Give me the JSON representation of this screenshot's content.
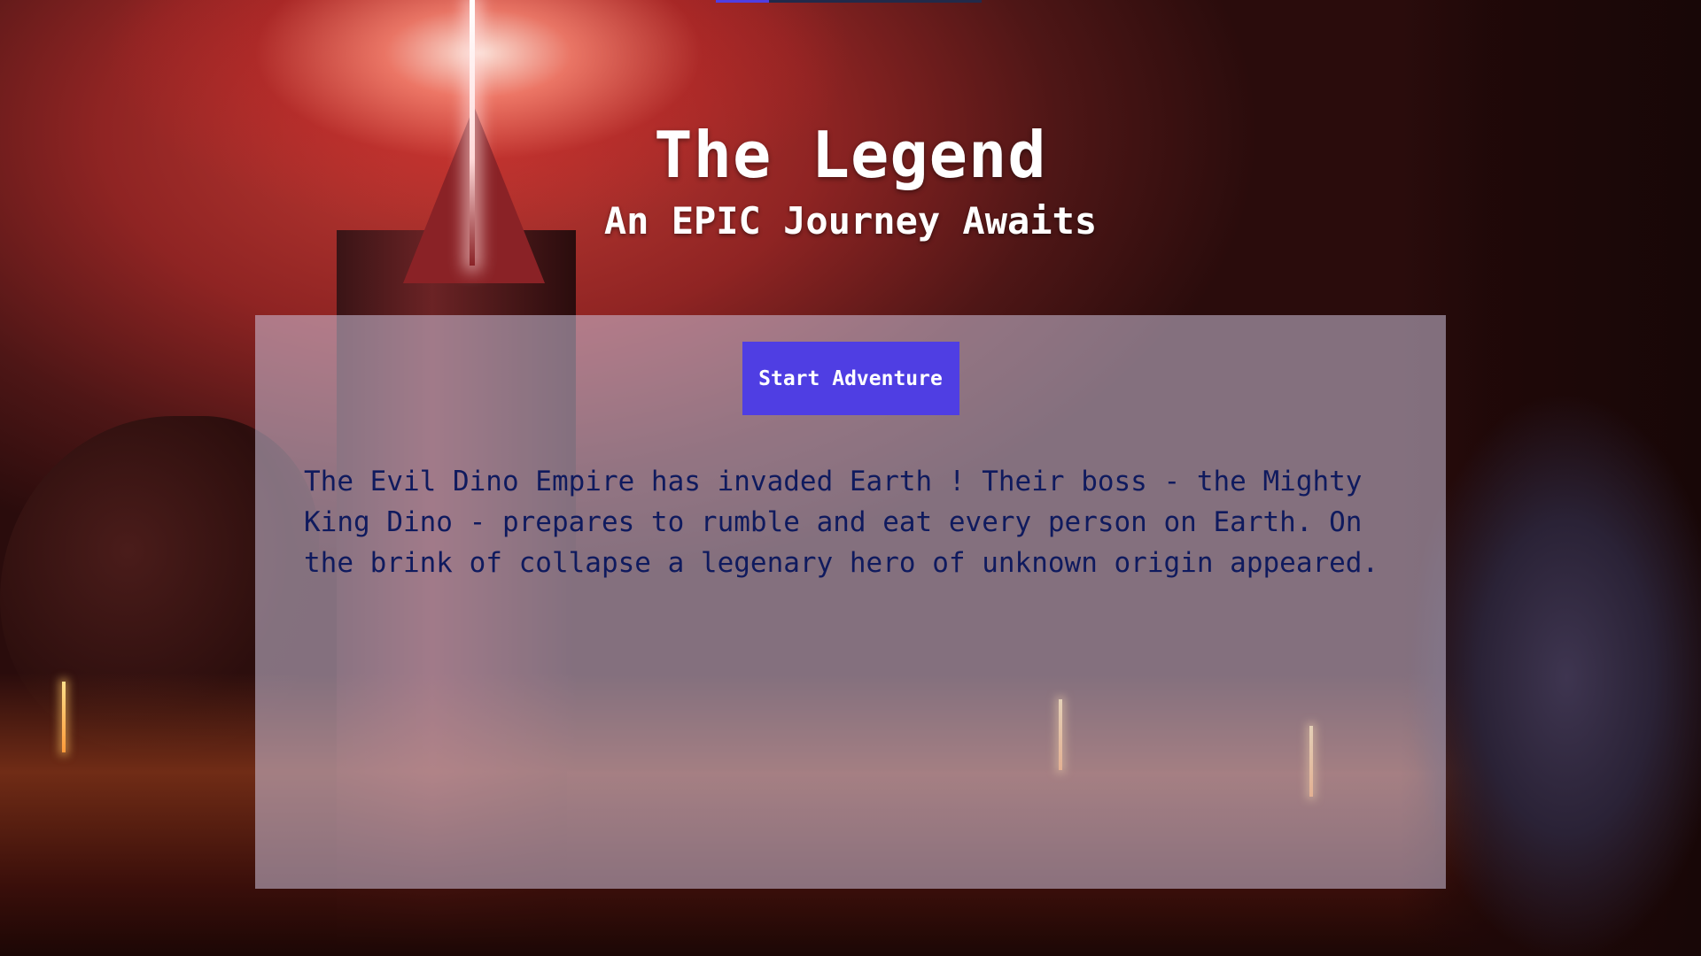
{
  "header": {
    "title": "The Legend",
    "subtitle": "An EPIC Journey Awaits"
  },
  "main": {
    "start_button_label": "Start Adventure",
    "story_text": "The Evil Dino Empire has invaded Earth ! Their boss - the Mighty King Dino - prepares to rumble and eat every person on Earth. On the brink of collapse a legenary hero of unknown origin appeared."
  },
  "colors": {
    "button_bg": "#4f3ee3",
    "story_text": "#0f1a5e",
    "title_text": "#ffffff"
  }
}
